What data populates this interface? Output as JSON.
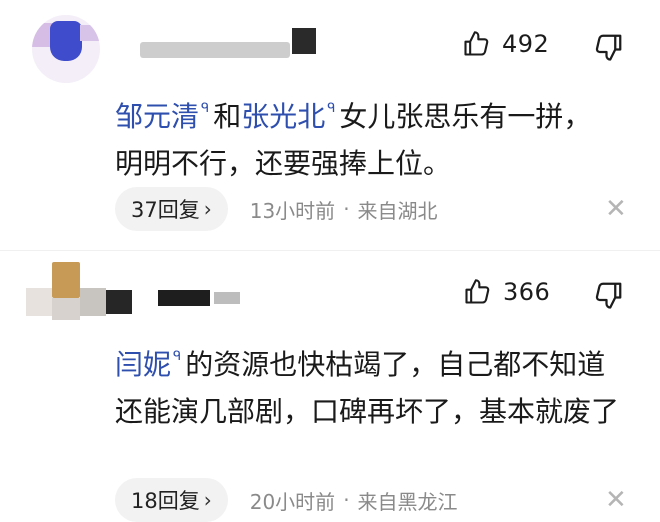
{
  "comments": [
    {
      "likes": "492",
      "mention": "邹元清",
      "connector": "和",
      "mention2": "张光北",
      "body": "女儿张思乐有一拼，明明不行，还要强捧上位。",
      "reply_label": "37回复",
      "time": "13小时前",
      "location": "来自湖北"
    },
    {
      "likes": "366",
      "mention": "闫妮",
      "body": "的资源也快枯竭了，自己都不知道还能演几部剧，口碑再坏了，基本就废了",
      "reply_label": "18回复",
      "time": "20小时前",
      "location": "来自黑龙江"
    }
  ],
  "icons": {
    "like": "thumbs-up-icon",
    "dislike": "thumbs-down-icon",
    "mention_marker": "search-pin-icon",
    "reply_chevron": "chevron-right-icon",
    "close": "close-icon"
  },
  "colors": {
    "mention": "#2f4fae",
    "meta": "#8a8a8a",
    "reply_bg": "#f2f2f2"
  },
  "glyphs": {
    "pin": "ᑫ",
    "chevron": "›",
    "dot": "·",
    "close": "✕"
  }
}
